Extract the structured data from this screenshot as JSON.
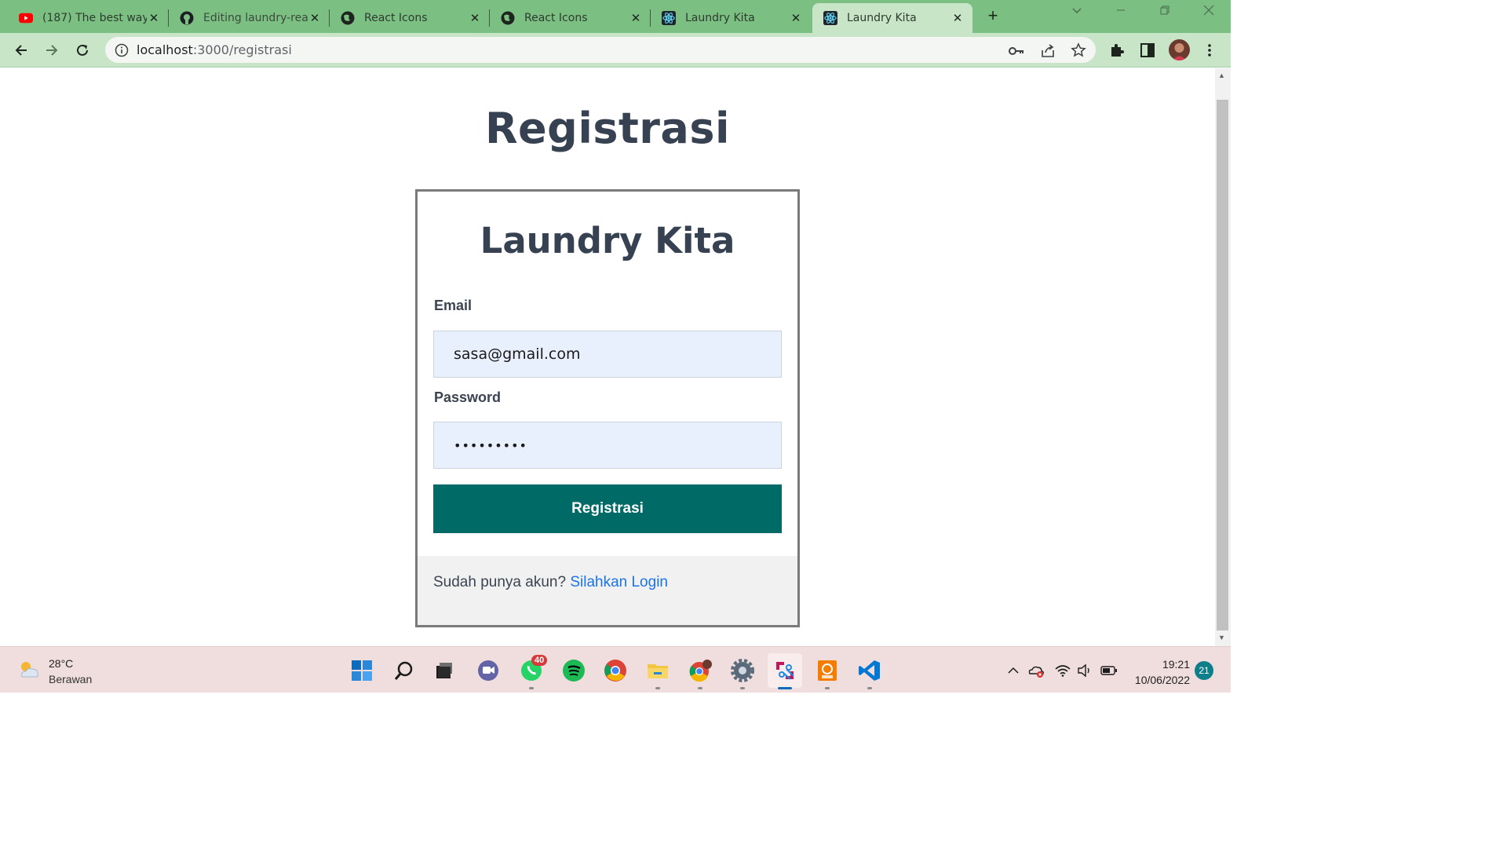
{
  "browser": {
    "tabs": [
      {
        "title": "(187) The best way",
        "favicon": "youtube-icon",
        "active": false
      },
      {
        "title": "Editing laundry-rea",
        "favicon": "github-icon",
        "active": false
      },
      {
        "title": "React Icons",
        "favicon": "globe-icon",
        "active": false
      },
      {
        "title": "React Icons",
        "favicon": "globe-icon",
        "active": false
      },
      {
        "title": "Laundry Kita",
        "favicon": "react-icon",
        "active": false
      },
      {
        "title": "Laundry Kita",
        "favicon": "react-icon",
        "active": true
      }
    ],
    "close_glyph": "✕",
    "newtab_glyph": "+",
    "address": {
      "host": "localhost",
      "path": ":3000/registrasi"
    },
    "theme_color": "#7cbf82"
  },
  "page": {
    "heading": "Registrasi",
    "card": {
      "brand": "Laundry Kita",
      "email_label": "Email",
      "email_value": "sasa@gmail.com",
      "password_label": "Password",
      "password_value": "•••••••••",
      "submit_label": "Registrasi",
      "footer_text": "Sudah punya akun?",
      "footer_link": "Silahkan Login"
    },
    "accent_color": "#006a66",
    "link_color": "#1a73e8"
  },
  "taskbar": {
    "weather": {
      "temp": "28°C",
      "desc": "Berawan"
    },
    "whatsapp_badge": "40",
    "clock": {
      "time": "19:21",
      "date": "10/06/2022"
    },
    "notifications": "21"
  }
}
